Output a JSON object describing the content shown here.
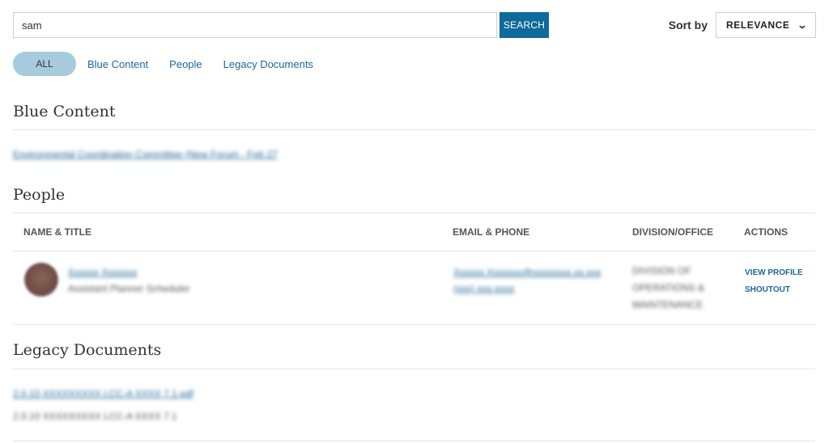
{
  "search": {
    "value": "sam",
    "button_label": "SEARCH"
  },
  "sort": {
    "label": "Sort by",
    "selected": "RELEVANCE"
  },
  "filters": [
    {
      "label": "ALL",
      "active": true
    },
    {
      "label": "Blue Content",
      "active": false
    },
    {
      "label": "People",
      "active": false
    },
    {
      "label": "Legacy Documents",
      "active": false
    }
  ],
  "blue_content": {
    "title": "Blue Content",
    "results": [
      {
        "text": "Environmental Coordination Committee (New Forum - Feb 27"
      }
    ]
  },
  "people": {
    "title": "People",
    "columns": [
      "NAME & TITLE",
      "EMAIL & PHONE",
      "DIVISION/OFFICE",
      "ACTIONS"
    ],
    "rows": [
      {
        "name": "Xxxxxx Xxxxxxx",
        "title": "Assistant Planner Scheduler",
        "email": "Xxxxxx.Xxxxxxx@xxxxxxxx.xx.xxx",
        "phone": "(xxx) xxx-xxxx",
        "division": [
          "DIVISION OF",
          "OPERATIONS &",
          "MAINTENANCE"
        ],
        "actions": [
          "VIEW PROFILE",
          "SHOUTOUT"
        ]
      }
    ]
  },
  "legacy": {
    "title": "Legacy Documents",
    "results": [
      {
        "link": "2.0.10 XXXXXXXXX LCC-A XXXX 7.1.pdf",
        "sub": "2.0.10 XXXXXXXXX LCC-A XXXX 7.1"
      }
    ]
  }
}
